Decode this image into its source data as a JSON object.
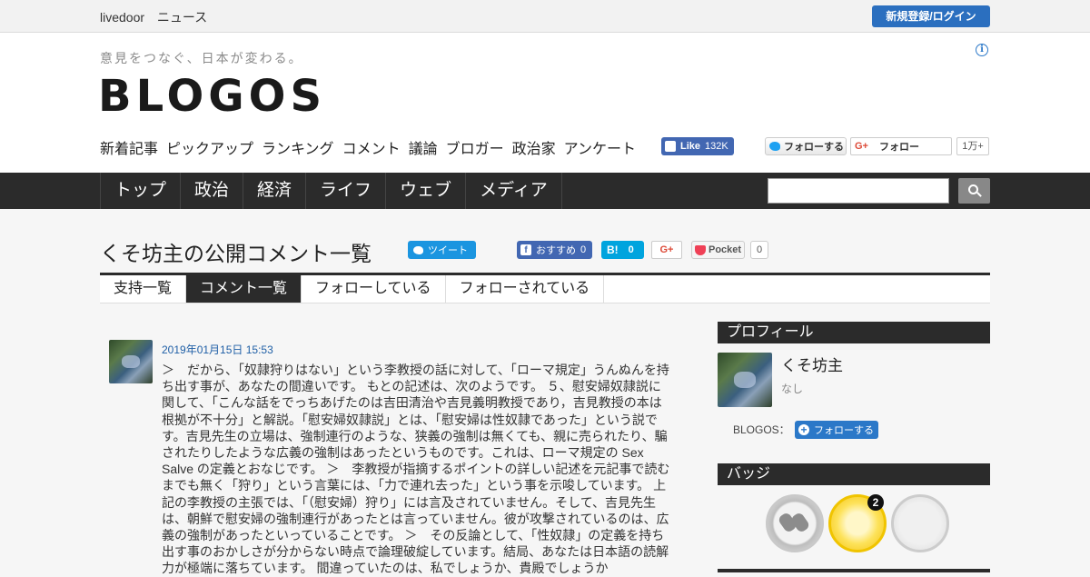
{
  "topbar": {
    "brand": "livedoor",
    "brand_sub": "ニュース",
    "login_label": "新規登録/ログイン"
  },
  "header": {
    "tagline": "意見をつなぐ、日本が変わる。",
    "logo": "BLOGOS",
    "info_icon": "i",
    "subnav": [
      "新着記事",
      "ピックアップ",
      "ランキング",
      "コメント",
      "議論",
      "ブロガー",
      "政治家",
      "アンケート"
    ],
    "fb_like_label": "Like",
    "fb_like_count": "132K",
    "twitter_follow_label": "フォローする",
    "gplus_label": "フォロー",
    "gplus_glyph": "G+",
    "gplus_count": "1万+"
  },
  "mainnav": {
    "items": [
      "トップ",
      "政治",
      "経済",
      "ライフ",
      "ウェブ",
      "メディア"
    ],
    "search_placeholder": ""
  },
  "page": {
    "title": "くそ坊主の公開コメント一覧",
    "share": {
      "tweet_label": "ツイート",
      "fb_label": "おすすめ",
      "fb_count": "0",
      "hatena_label": "B!",
      "hatena_count": "0",
      "gplus_label": "G+",
      "pocket_label": "Pocket",
      "pocket_count": "0"
    },
    "tabs": [
      "支持一覧",
      "コメント一覧",
      "フォローしている",
      "フォローされている"
    ],
    "active_tab": 1
  },
  "comment": {
    "date": "2019年01月15日 15:53",
    "body": "＞　だから、「奴隷狩りはない」という李教授の話に対して、「ローマ規定」うんぬんを持ち出す事が、あなたの間違いです。 もとの記述は、次のようです。 ５、慰安婦奴隷説に関して、「こんな話をでっちあげたのは吉田清治や吉見義明教授であり，吉見教授の本は根拠が不十分」と解説。「慰安婦奴隷説」とは、「慰安婦は性奴隷であった」という説です。吉見先生の立場は、強制連行のような、狭義の強制は無くても、親に売られたり、騙されたりしたような広義の強制はあったというものです。これは、ローマ規定の Sex Salve の定義とおなじです。 ＞　李教授が指摘するポイントの詳しい記述を元記事で読むまでも無く「狩り」という言葉には、「力で連れ去った」という事を示唆しています。 上記の李教授の主張では、「（慰安婦）狩り」には言及されていません。そして、吉見先生は、朝鮮で慰安婦の強制連行があったとは言っていません。彼が攻撃されているのは、広義の強制があったといっていることです。 ＞　その反論として、「性奴隷」の定義を持ち出す事のおかしさが分からない時点で論理破綻しています。結局、あなたは日本語の読解力が極端に落ちています。 間違っていたのは、私でしょうか、貴殿でしょうか"
  },
  "sidebar": {
    "profile_heading": "プロフィール",
    "profile_name": "くそ坊主",
    "profile_desc": "なし",
    "blogos_label": "BLOGOS：",
    "follow_label": "フォローする",
    "badge_heading": "バッジ",
    "badge_count": "2"
  },
  "colors": {
    "accent": "#2b78c8",
    "nav_bg": "#2b2b2b",
    "badge_gold": "#f4c20d"
  }
}
